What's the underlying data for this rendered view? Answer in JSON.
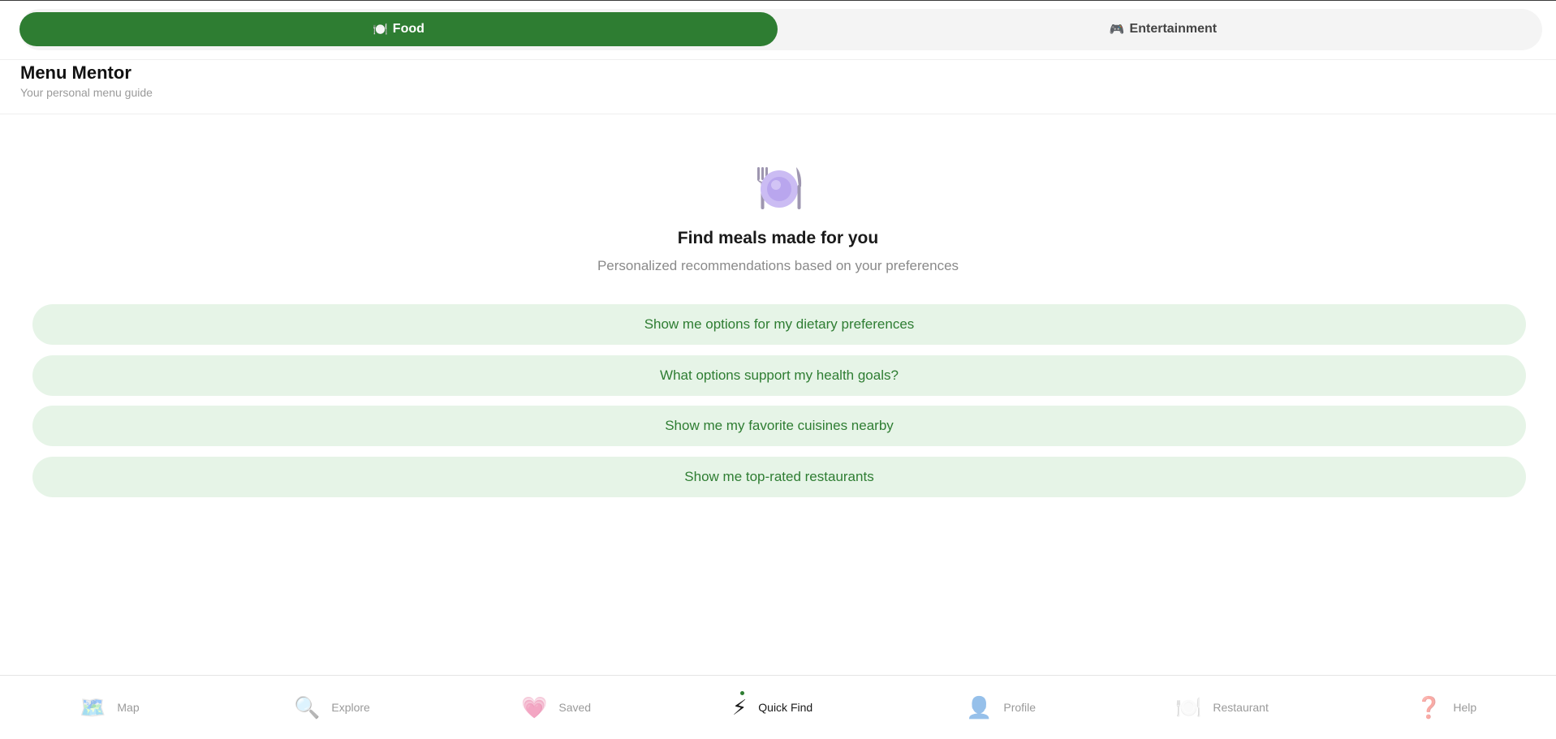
{
  "mode_toggle": {
    "food": {
      "icon": "plate-icon",
      "label": "Food",
      "active": true
    },
    "entertainment": {
      "icon": "gamepad-icon",
      "label": "Entertainment",
      "active": false
    }
  },
  "header": {
    "title": "Menu Mentor",
    "subtitle": "Your personal menu guide"
  },
  "hero": {
    "icon": "fork-knife-plate-icon",
    "title": "Find meals made for you",
    "subtitle": "Personalized recommendations based on your preferences"
  },
  "prompts": [
    "Show me options for my dietary preferences",
    "What options support my health goals?",
    "Show me my favorite cuisines nearby",
    "Show me top-rated restaurants"
  ],
  "bottom_nav": [
    {
      "icon": "map-icon",
      "label": "Map",
      "active": false
    },
    {
      "icon": "search-icon",
      "label": "Explore",
      "active": false
    },
    {
      "icon": "heart-icon",
      "label": "Saved",
      "active": false
    },
    {
      "icon": "lightning-icon",
      "label": "Quick Find",
      "active": true
    },
    {
      "icon": "profile-icon",
      "label": "Profile",
      "active": false
    },
    {
      "icon": "plate-icon",
      "label": "Restaurant",
      "active": false
    },
    {
      "icon": "question-icon",
      "label": "Help",
      "active": false
    }
  ],
  "colors": {
    "accent": "#2e7d32",
    "prompt_bg": "#e6f4e7",
    "toggle_bg": "#f4f4f4"
  }
}
